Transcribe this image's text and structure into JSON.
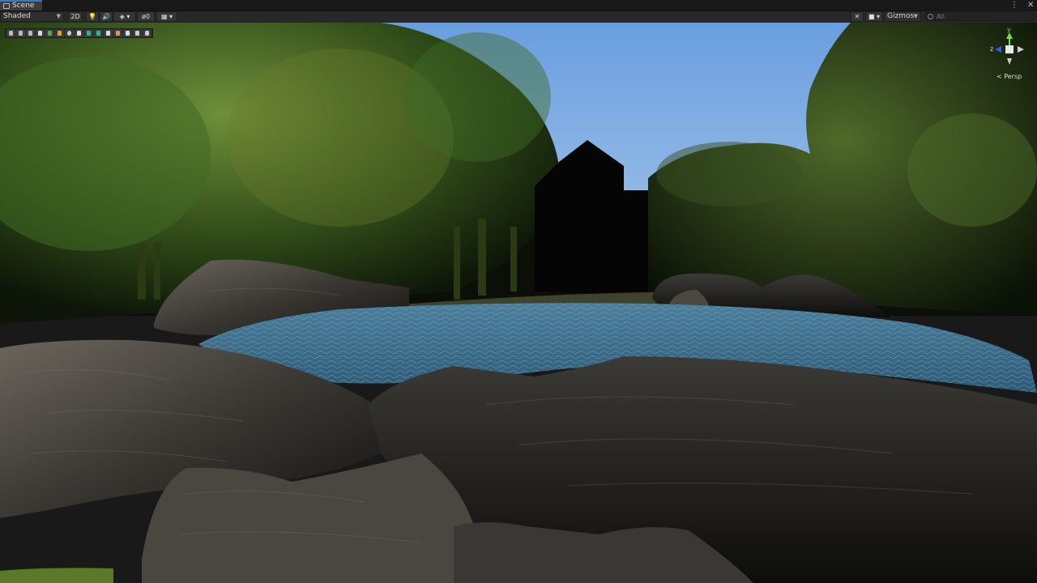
{
  "window": {
    "tab_title": "Scene",
    "menu_icon": "kebab-icon",
    "close_icon": "close-icon"
  },
  "toolbar": {
    "draw_mode": "Shaded",
    "toggle_2d": "2D",
    "hidden_count": "0",
    "gizmos_label": "Gizmos",
    "search_placeholder": "All"
  },
  "gizmo": {
    "projection": "Persp",
    "axis_y": "y",
    "axis_z": "z"
  },
  "colors": {
    "accent": "#3a79bb",
    "sky": "#7faee6",
    "water": "#3f6e8c"
  }
}
